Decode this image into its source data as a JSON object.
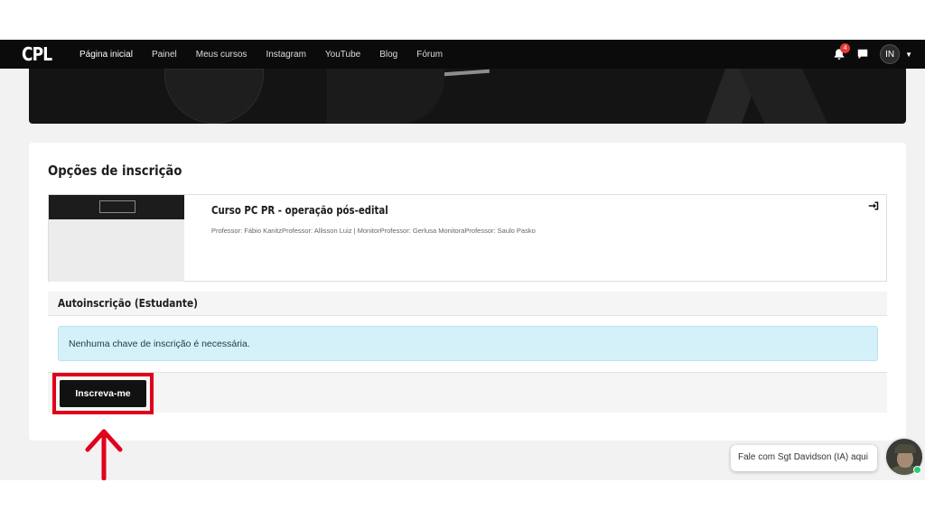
{
  "navbar": {
    "logo_text": "CPL",
    "links": [
      "Página inicial",
      "Painel",
      "Meus cursos",
      "Instagram",
      "YouTube",
      "Blog",
      "Fórum"
    ],
    "notification_count": "4",
    "user_initials": "IN",
    "icons": [
      "bell-icon",
      "chat-bubble-icon",
      "chevron-down-icon"
    ]
  },
  "page": {
    "title": "Opções de inscrição"
  },
  "course": {
    "name": "Curso PC PR - operação pós-edital",
    "teachers": "Professor: Fábio KanitzProfessor: Allisson Luiz | MonitorProfessor: Gerlusa MonitoraProfessor: Saulo Pasko"
  },
  "self_enrolment": {
    "header": "Autoinscrição (Estudante)",
    "info": "Nenhuma chave de inscrição é necessária.",
    "button_label": "Inscreva-me"
  },
  "chat_widget": {
    "label": "Fale com Sgt Davidson (IA) aqui"
  },
  "colors": {
    "navbar": "#0b0b0b",
    "highlight": "#e0001b",
    "info_bg": "#d4f1f9",
    "online": "#2ecc71"
  }
}
